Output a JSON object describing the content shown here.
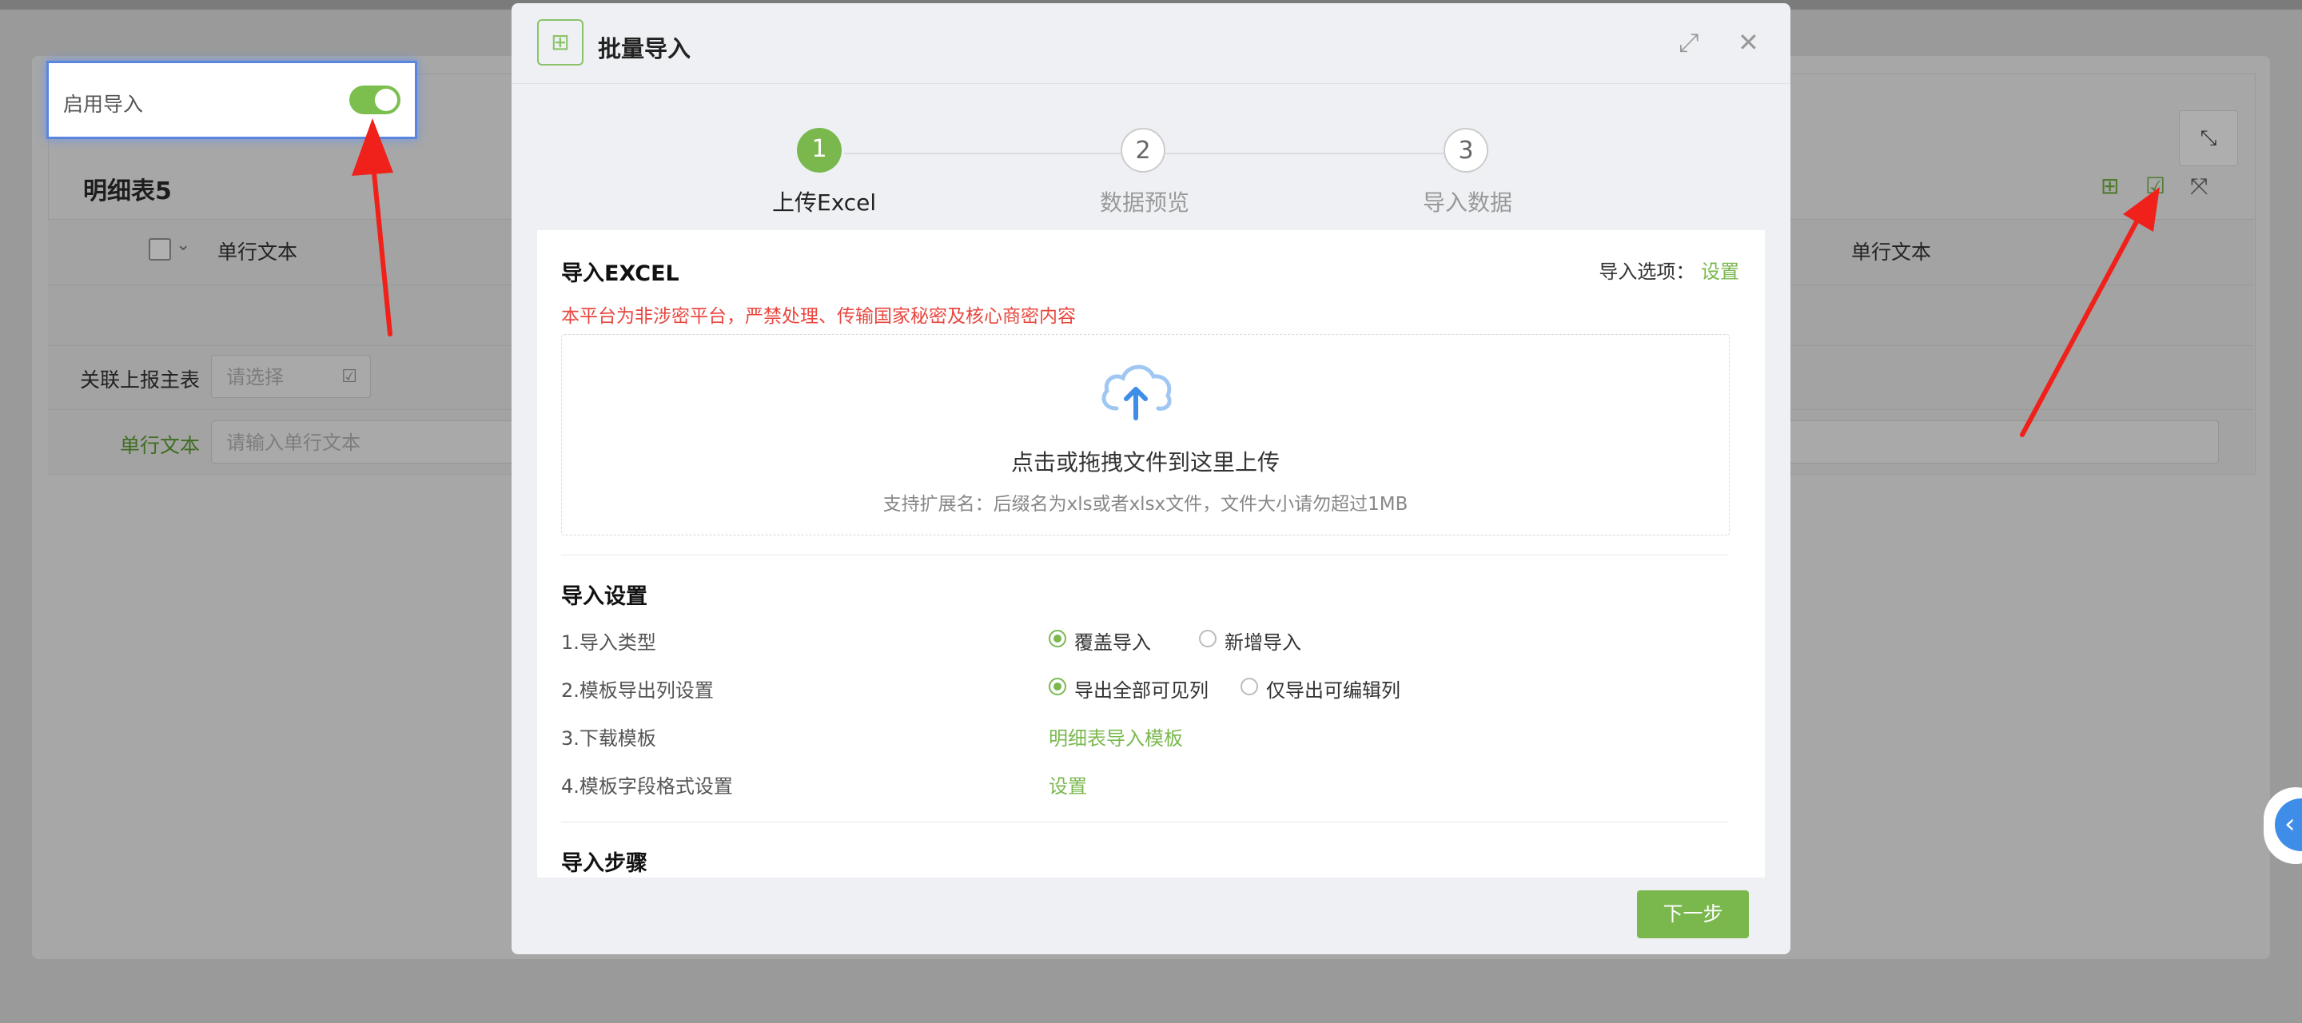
{
  "background": {
    "table_title": "明细表5",
    "column_header_left": "单行文本",
    "column_header_right": "单行文本",
    "related_label": "关联上报主表",
    "related_placeholder": "请选择",
    "text_label": "单行文本",
    "text_placeholder": "请输入单行文本"
  },
  "highlight": {
    "label": "启用导入",
    "enabled": true
  },
  "modal": {
    "title": "批量导入",
    "steps": [
      {
        "number": "1",
        "label": "上传Excel",
        "active": true
      },
      {
        "number": "2",
        "label": "数据预览",
        "active": false
      },
      {
        "number": "3",
        "label": "导入数据",
        "active": false
      }
    ],
    "import_excel": {
      "title": "导入EXCEL",
      "options_label": "导入选项：",
      "options_link": "设置",
      "warning": "本平台为非涉密平台，严禁处理、传输国家秘密及核心商密内容",
      "drop_main": "点击或拖拽文件到这里上传",
      "drop_sub": "支持扩展名：后缀名为xls或者xlsx文件，文件大小请勿超过1MB"
    },
    "settings": {
      "title": "导入设置",
      "rows": [
        {
          "label": "1.导入类型",
          "options": [
            "覆盖导入",
            "新增导入"
          ],
          "selected": 0
        },
        {
          "label": "2.模板导出列设置",
          "options": [
            "导出全部可见列",
            "仅导出可编辑列"
          ],
          "selected": 0
        },
        {
          "label": "3.下载模板",
          "link": "明细表导入模板"
        },
        {
          "label": "4.模板字段格式设置",
          "link": "设置"
        }
      ]
    },
    "steps_section_title": "导入步骤",
    "next_button": "下一步"
  },
  "colors": {
    "accent": "#7ab84e",
    "warning": "#e8473f",
    "arrow": "#f0201a"
  },
  "icons": [
    "excel-import-icon",
    "expand-icon",
    "close-icon",
    "upload-cloud-icon",
    "fullscreen-icon",
    "add-icon",
    "import-icon",
    "collapse-icon"
  ]
}
